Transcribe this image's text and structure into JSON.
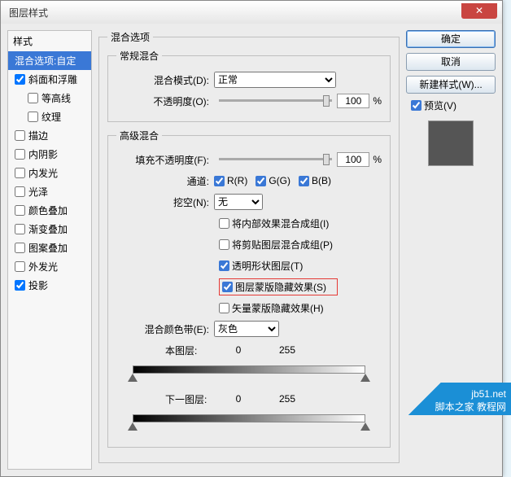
{
  "dialog": {
    "title": "图层样式"
  },
  "left": {
    "header": "样式",
    "blend_opts": "混合选项:自定",
    "items": [
      {
        "label": "斜面和浮雕",
        "checked": true
      },
      {
        "label": "等高线",
        "checked": false,
        "sub": true
      },
      {
        "label": "纹理",
        "checked": false,
        "sub": true
      },
      {
        "label": "描边",
        "checked": false
      },
      {
        "label": "内阴影",
        "checked": false
      },
      {
        "label": "内发光",
        "checked": false
      },
      {
        "label": "光泽",
        "checked": false
      },
      {
        "label": "颜色叠加",
        "checked": false
      },
      {
        "label": "渐变叠加",
        "checked": false
      },
      {
        "label": "图案叠加",
        "checked": false
      },
      {
        "label": "外发光",
        "checked": false
      },
      {
        "label": "投影",
        "checked": true
      }
    ]
  },
  "mid": {
    "section_title": "混合选项",
    "normal": {
      "legend": "常规混合",
      "blendmode_label": "混合模式(D):",
      "blendmode_value": "正常",
      "opacity_label": "不透明度(O):",
      "opacity_value": "100",
      "percent": "%"
    },
    "advanced": {
      "legend": "高级混合",
      "fill_label": "填充不透明度(F):",
      "fill_value": "100",
      "channels_label": "通道:",
      "r": "R(R)",
      "g": "G(G)",
      "b": "B(B)",
      "knockout_label": "挖空(N):",
      "knockout_value": "无",
      "opt1": "将内部效果混合成组(I)",
      "opt2": "将剪贴图层混合成组(P)",
      "opt3": "透明形状图层(T)",
      "opt4": "图层蒙版隐藏效果(S)",
      "opt5": "矢量蒙版隐藏效果(H)",
      "blendif_label": "混合颜色带(E):",
      "blendif_value": "灰色",
      "this_label": "本图层:",
      "under_label": "下一图层:",
      "v0": "0",
      "v255": "255"
    }
  },
  "right": {
    "ok": "确定",
    "cancel": "取消",
    "newstyle": "新建样式(W)...",
    "preview": "预览(V)"
  },
  "watermark": {
    "l1": "jb51.net",
    "l2": "脚本之家 教程网"
  }
}
